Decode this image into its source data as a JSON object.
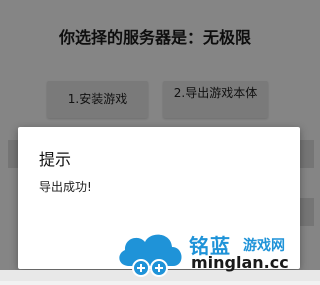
{
  "screen": {
    "heading": "你选择的服务器是：无极限",
    "install_button": "1.安装游戏",
    "export_button": "2.导出游戏本体"
  },
  "dialog": {
    "title": "提示",
    "message": "导出成功!"
  },
  "watermark": {
    "name": "铭蓝",
    "subtitle": "游戏网",
    "domain": "minglan.cc",
    "color": "#1f93d8"
  }
}
